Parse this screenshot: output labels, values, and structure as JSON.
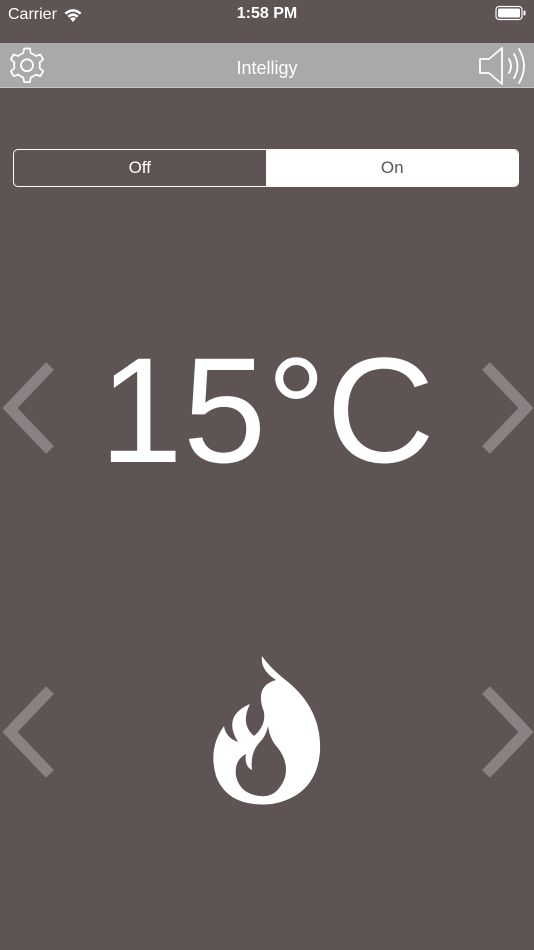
{
  "status_bar": {
    "carrier": "Carrier",
    "time": "1:58 PM"
  },
  "nav": {
    "title": "Intelligy",
    "left_icon": "gear-icon",
    "right_icon": "speaker-volume-icon"
  },
  "power_toggle": {
    "options": [
      "Off",
      "On"
    ],
    "selected": "On"
  },
  "temperature": {
    "value": "15°C"
  },
  "mode": {
    "icon": "flame-icon"
  },
  "colors": {
    "background": "#5e5454",
    "nav_bar": "#a9a9a9",
    "foreground": "#ffffff",
    "chevron": "#8a8282"
  }
}
